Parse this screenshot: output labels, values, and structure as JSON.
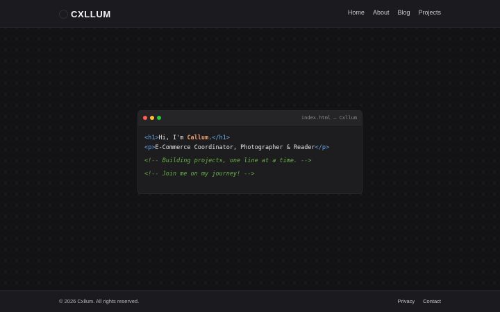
{
  "header": {
    "brand": "CXLLUM",
    "logo_icon": "circle-logo-icon",
    "nav": [
      {
        "label": "Home"
      },
      {
        "label": "About"
      },
      {
        "label": "Blog"
      },
      {
        "label": "Projects"
      }
    ]
  },
  "editor": {
    "file_title": "index.html — Cxllum",
    "window_dots": {
      "red": "#ff5f56",
      "yellow": "#ffbd2e",
      "green": "#27c93f"
    },
    "code": {
      "h1_open": "<h1>",
      "h1_text": "Hi, I'm ",
      "h1_name": "Callum",
      "h1_period": ".",
      "h1_close": "</h1>",
      "p_open": "<p>",
      "p_text": "E-Commerce Coordinator, Photographer & Reader",
      "p_close": "</p>",
      "comment_1": "<!-- Building projects, one line at a time. -->",
      "comment_2": "<!-- Join me on my journey! -->"
    },
    "colors": {
      "tag": "#6aa9e6",
      "name": "#f0a070",
      "comment": "#6ab04c"
    }
  },
  "footer": {
    "copyright": "© 2026 Cxllum. All rights reserved.",
    "links": [
      {
        "label": "Privacy"
      },
      {
        "label": "Contact"
      }
    ]
  }
}
